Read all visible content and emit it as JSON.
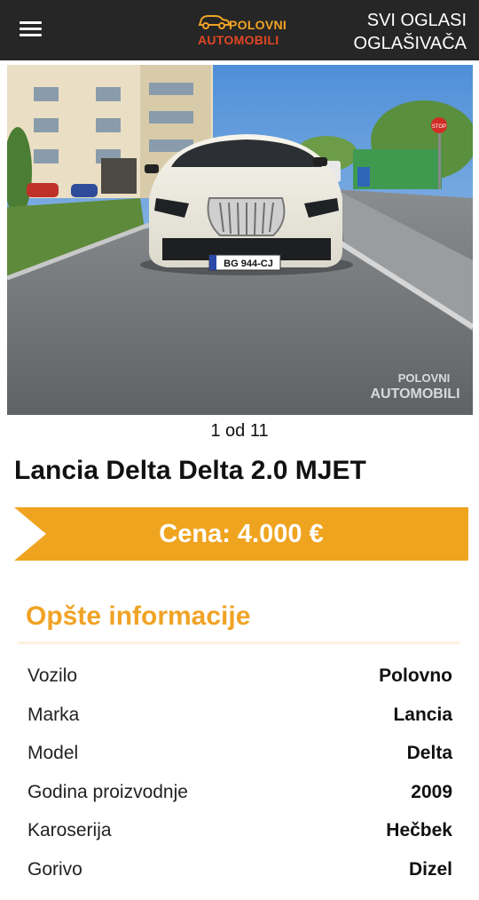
{
  "header": {
    "menu_icon": "hamburger-menu-icon",
    "logo": {
      "line1": "POLOVNI",
      "line2": "AUTOMOBILI",
      "colors": {
        "line1": "#f0a325",
        "line2": "#e04623"
      }
    },
    "ads_link": {
      "line1": "SVI OGLASI",
      "line2": "OGLAŠIVAČA"
    }
  },
  "gallery": {
    "license_plate": "BG 944-CJ",
    "stop_sign": "STOP",
    "watermark": {
      "line1": "POLOVNI",
      "line2": "AUTOMOBILI"
    },
    "counter": "1 od 11"
  },
  "listing": {
    "title": "Lancia Delta Delta 2.0 MJET",
    "price": "Cena: 4.000 €",
    "price_color": "#efa420"
  },
  "info": {
    "section_title": "Opšte informacije",
    "rows": [
      {
        "label": "Vozilo",
        "value": "Polovno"
      },
      {
        "label": "Marka",
        "value": "Lancia"
      },
      {
        "label": "Model",
        "value": "Delta"
      },
      {
        "label": "Godina proizvodnje",
        "value": "2009"
      },
      {
        "label": "Karoserija",
        "value": "Hečbek"
      },
      {
        "label": "Gorivo",
        "value": "Dizel"
      }
    ]
  }
}
